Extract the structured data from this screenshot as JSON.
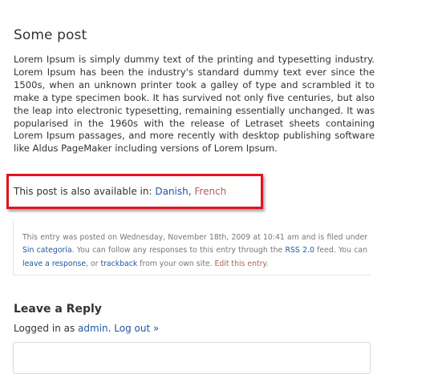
{
  "post": {
    "title": "Some post",
    "body": "Lorem Ipsum is simply dummy text of the printing and typesetting industry. Lorem Ipsum has been the industry's standard dummy text ever since the 1500s, when an unknown printer took a galley of type and scrambled it to make a type specimen book. It has survived not only five centuries, but also the leap into electronic typesetting, remaining essentially unchanged. It was popularised in the 1960s with the release of Letraset sheets containing Lorem Ipsum passages, and more recently with desktop publishing software like Aldus PageMaker including versions of Lorem Ipsum."
  },
  "languages": {
    "prefix": "This post is also available in: ",
    "items": [
      "Danish",
      "French"
    ],
    "separator": ", "
  },
  "highlight": {
    "color": "#e2141c"
  },
  "postmeta": {
    "t1": "This entry was posted on Wednesday, November 18th, 2009 at 10:41 am and is filed under ",
    "category": "Sin categoría",
    "t2": ". You can follow any responses to this entry through the ",
    "rss": "RSS 2.0",
    "t3": " feed. You can ",
    "leave_response": "leave a response",
    "t4": ", or ",
    "trackback": "trackback",
    "t5": " from your own site. ",
    "edit": "Edit this entry",
    "t6": "."
  },
  "reply": {
    "heading": "Leave a Reply",
    "logged_prefix": "Logged in as ",
    "user": "admin",
    "logged_sep": ". ",
    "logout": "Log out »"
  },
  "colors": {
    "link": "#2255a4",
    "visited_link": "#b06060",
    "text": "#333333"
  }
}
